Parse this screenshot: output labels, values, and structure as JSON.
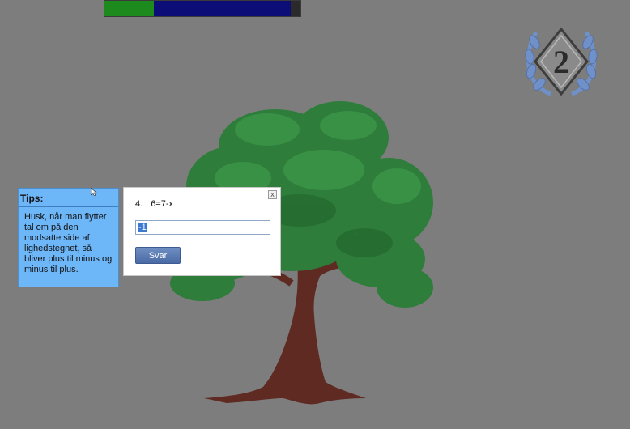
{
  "progress": {
    "green_fraction": 0.25,
    "blue_fraction": 0.7,
    "green_color": "#1d8a1d",
    "blue_color": "#0d0d78"
  },
  "level_badge": {
    "number": "2",
    "icon": "laurel-diamond-icon"
  },
  "tips": {
    "title": "Tips:",
    "body": "Husk, når man flytter tal om på den modsatte side af lighedstegnet, så bliver plus til minus og minus til plus."
  },
  "question": {
    "number": "4.",
    "equation": "6=7-x",
    "answer_value": "-1",
    "submit_label": "Svar",
    "close_label": "x"
  }
}
